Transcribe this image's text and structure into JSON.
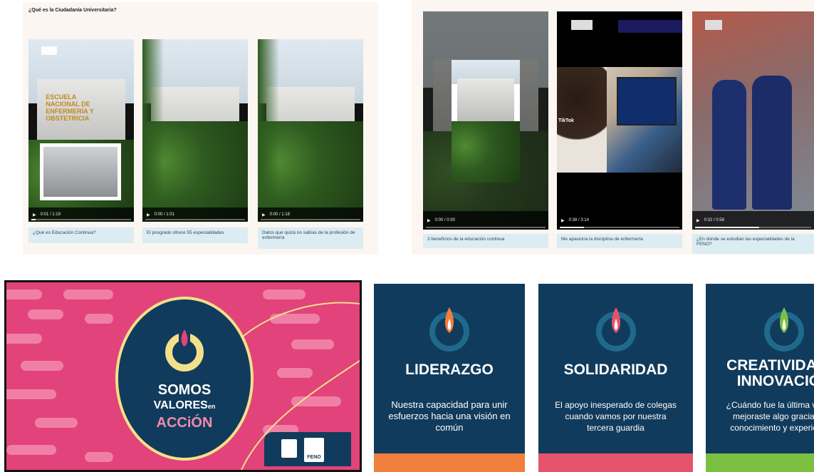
{
  "panel_a": {
    "title": "¿Qué es la Ciudadanía Universitaria?",
    "videos": [
      {
        "time": "0:01 / 1:19",
        "caption": "¿Qué es Educación Continua?",
        "progress": 0.02
      },
      {
        "time": "0:00 / 1:01",
        "caption": "El posgrado ofrece 55 especialidades",
        "progress": 0.0
      },
      {
        "time": "0:00 / 1:18",
        "caption": "Datos que quizá no sabías de la profesión de enfermería",
        "progress": 0.0
      }
    ],
    "sign_text": "Escuela Nacional de Enfermería y Obstetricia"
  },
  "panel_b": {
    "videos": [
      {
        "time": "0:00 / 0:30",
        "caption": "3 beneficios de la educación continua",
        "progress": 0.0
      },
      {
        "time": "0:38 / 3:14",
        "caption": "Me apasiona la disciplina de enfermería",
        "progress": 0.2,
        "overlay": "TikTok"
      },
      {
        "time": "0:32 / 0:58",
        "caption": "¿En dónde se estudian las especialidades de la FENO?",
        "progress": 0.55
      }
    ]
  },
  "panel_c": {
    "line1": "SOMOS",
    "line2": "VALORES",
    "line2_small": "en",
    "line3": "ACCiÓN",
    "badge": "FENO",
    "colors": {
      "background": "#e2437a",
      "circle": "#113b5c",
      "ring": "#f3e08a",
      "accent": "#f28aa8"
    }
  },
  "panel_d": {
    "cards": [
      {
        "title": "LIDERAZGO",
        "desc": "Nuestra capacidad para unir esfuerzos hacia una visión en común",
        "bar_color": "#f07f3c",
        "flame_color": "#f07f3c"
      },
      {
        "title": "SOLIDARIDAD",
        "desc": "El apoyo inesperado de colegas cuando vamos por nuestra tercera guardia",
        "bar_color": "#e5546a",
        "flame_color": "#e5546a"
      },
      {
        "title": "CREATIVIDAD E INNOVACIÓN",
        "desc": "¿Cuándo fue la última vez que mejoraste algo gracias a tu conocimiento y experiencia?",
        "bar_color": "#7cc043",
        "flame_color": "#7cc043"
      }
    ],
    "footer_text": "Somos VALORES en ACCIÓN"
  }
}
